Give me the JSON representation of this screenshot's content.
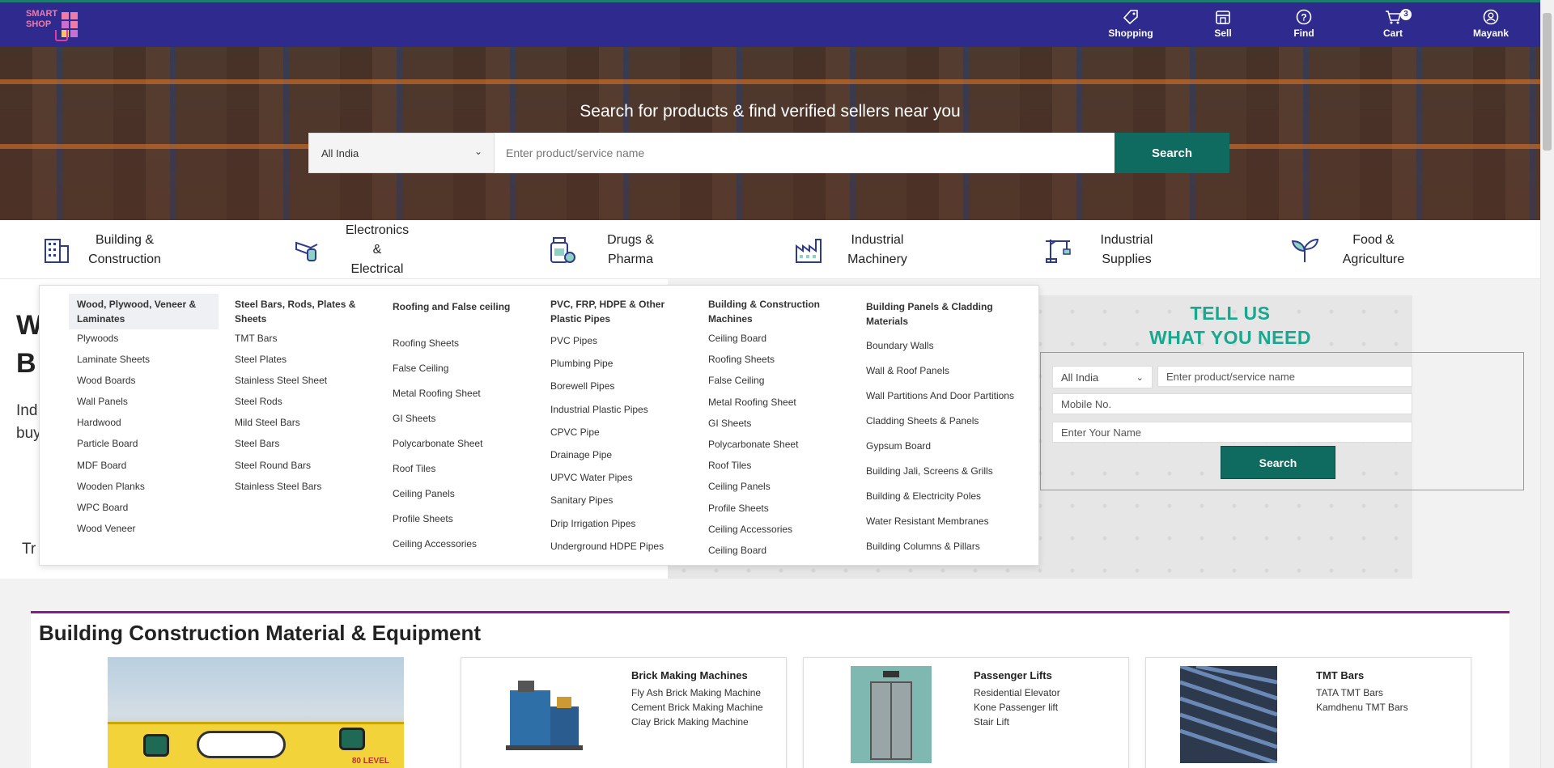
{
  "brand": {
    "logo_text": "SMART SHOP"
  },
  "nav": {
    "shopping": "Shopping",
    "sell": "Sell",
    "find": "Find",
    "cart": "Cart",
    "cart_count": "3",
    "user": "Mayank"
  },
  "hero": {
    "title": "Search for products & find verified sellers near you",
    "location": "All India",
    "search_placeholder": "Enter product/service name",
    "search_button": "Search"
  },
  "categories": [
    {
      "label_line1": "Building &",
      "label_line2": "Construction",
      "icon": "building-icon"
    },
    {
      "label_line1": "Electronics",
      "label_line2": "&",
      "label_line3": "Electrical",
      "icon": "drill-icon"
    },
    {
      "label_line1": "Drugs &",
      "label_line2": "Pharma",
      "icon": "medicine-icon"
    },
    {
      "label_line1": "Industrial",
      "label_line2": "Machinery",
      "icon": "factory-icon"
    },
    {
      "label_line1": "Industrial",
      "label_line2": "Supplies",
      "icon": "crane-icon"
    },
    {
      "label_line1": "Food &",
      "label_line2": "Agriculture",
      "icon": "sprout-icon"
    }
  ],
  "background": {
    "heading_1": "W",
    "heading_2": "B",
    "para_1": "Ind",
    "para_2": "buy",
    "trust": "Tr"
  },
  "tell_us": {
    "line1": "TELL US",
    "line2": "WHAT YOU NEED",
    "location": "All India",
    "product_placeholder": "Enter product/service name",
    "mobile_placeholder": "Mobile No.",
    "name_placeholder": "Enter Your Name",
    "button": "Search"
  },
  "mega_menu": {
    "columns": [
      {
        "head": "Wood, Plywood, Veneer & Laminates",
        "items": [
          "Plywoods",
          "Laminate Sheets",
          "Wood Boards",
          "Wall Panels",
          "Hardwood",
          "Particle Board",
          "MDF Board",
          "Wooden Planks",
          "WPC Board",
          "Wood Veneer"
        ]
      },
      {
        "head": "Steel Bars, Rods, Plates & Sheets",
        "items": [
          "TMT Bars",
          "Steel Plates",
          "Stainless Steel Sheet",
          "Steel Rods",
          "Mild Steel Bars",
          "Steel Bars",
          "Steel Round Bars",
          "Stainless Steel Bars"
        ]
      },
      {
        "head": "Roofing and False ceiling",
        "items": [
          "Roofing Sheets",
          "False Ceiling",
          "Metal Roofing Sheet",
          "GI Sheets",
          "Polycarbonate Sheet",
          "Roof Tiles",
          "Ceiling Panels",
          "Profile Sheets",
          "Ceiling Accessories"
        ]
      },
      {
        "head": "PVC, FRP, HDPE & Other Plastic Pipes",
        "items": [
          "PVC Pipes",
          "Plumbing Pipe",
          "Borewell Pipes",
          "Industrial Plastic Pipes",
          "CPVC Pipe",
          "Drainage Pipe",
          "UPVC Water Pipes",
          "Sanitary Pipes",
          "Drip Irrigation Pipes",
          "Underground HDPE Pipes"
        ]
      },
      {
        "head": "Building & Construction Machines",
        "items": [
          "Ceiling Board",
          "Roofing Sheets",
          "False Ceiling",
          "Metal Roofing Sheet",
          "GI Sheets",
          "Polycarbonate Sheet",
          "Roof Tiles",
          "Ceiling Panels",
          "Profile Sheets",
          "Ceiling Accessories",
          "Ceiling Board"
        ]
      },
      {
        "head": "Building Panels & Cladding Materials",
        "items": [
          "Boundary Walls",
          "Wall & Roof Panels",
          "Wall Partitions And Door Partitions",
          "Cladding Sheets & Panels",
          "Gypsum Board",
          "Building Jali, Screens & Grills",
          "Building & Electricity Poles",
          "Water Resistant Membranes",
          "Building Columns & Pillars"
        ]
      }
    ]
  },
  "section": {
    "title": "Building Construction Material & Equipment",
    "hero_image_text": "80 LEVEL",
    "cards": [
      {
        "title": "Brick Making Machines",
        "items": [
          "Fly Ash Brick Making Machine",
          "Cement Brick Making Machine",
          "Clay Brick Making Machine"
        ]
      },
      {
        "title": "Passenger Lifts",
        "items": [
          "Residential Elevator",
          "Kone Passenger lift",
          "Stair Lift"
        ]
      },
      {
        "title": "TMT Bars",
        "items": [
          "TATA TMT Bars",
          "Kamdhenu TMT Bars"
        ]
      }
    ]
  },
  "colors": {
    "nav_bg": "#2e2a8e",
    "accent": "#0f6a5f",
    "tell_title": "#17a88f",
    "section_border": "#8b1a8b"
  }
}
